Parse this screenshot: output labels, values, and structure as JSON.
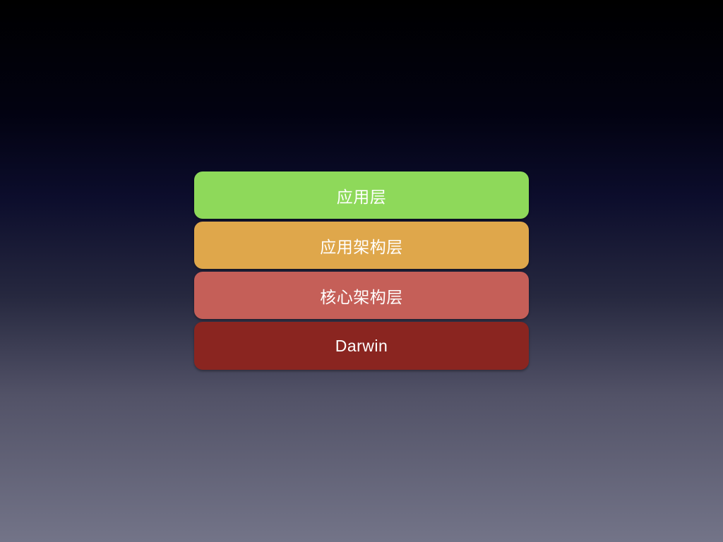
{
  "diagram": {
    "layers": [
      {
        "label": "应用层",
        "color": "#8ed95a"
      },
      {
        "label": "应用架构层",
        "color": "#dfa74b"
      },
      {
        "label": "核心架构层",
        "color": "#c55f58"
      },
      {
        "label": "Darwin",
        "color": "#8a2520"
      }
    ]
  }
}
